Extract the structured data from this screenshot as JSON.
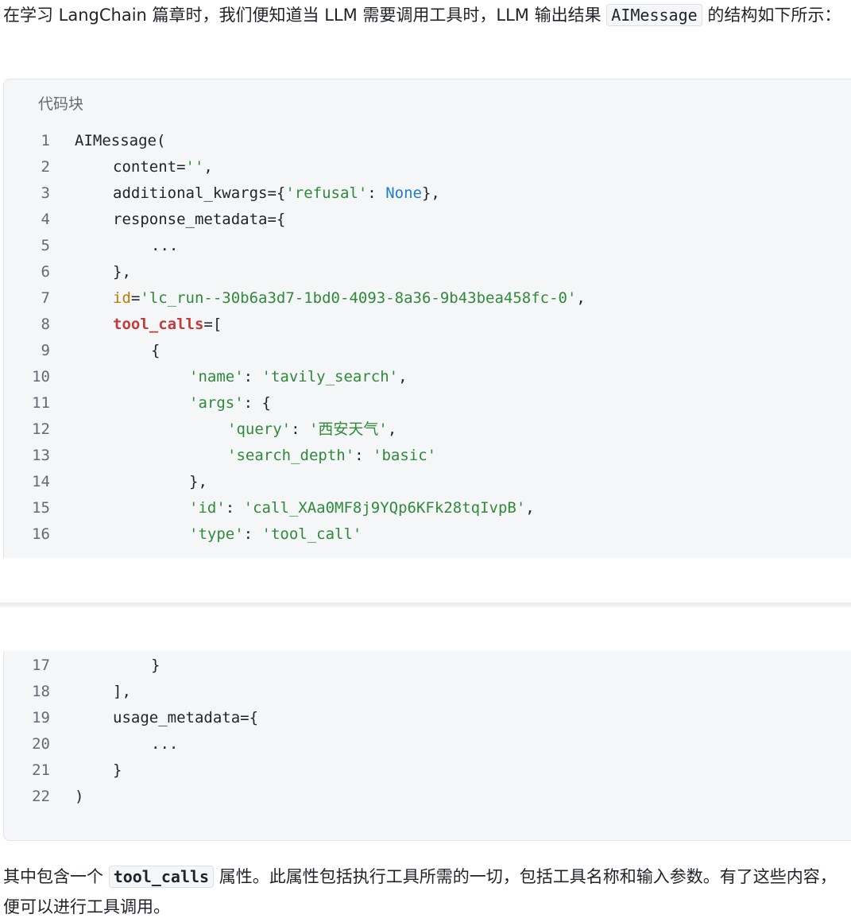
{
  "intro": {
    "text_before": "在学习 LangChain 篇章时，我们便知道当 LLM 需要调用工具时，LLM 输出结果 ",
    "code": "AIMessage",
    "text_after": " 的结构如下所示："
  },
  "code_block": {
    "label": "代码块",
    "lines": [
      {
        "n": "1",
        "indent": 0,
        "parts": [
          {
            "t": "AIMessage("
          }
        ]
      },
      {
        "n": "2",
        "indent": 1,
        "parts": [
          {
            "t": "content="
          },
          {
            "t": "''",
            "c": "str"
          },
          {
            "t": ","
          }
        ]
      },
      {
        "n": "3",
        "indent": 1,
        "parts": [
          {
            "t": "additional_kwargs={"
          },
          {
            "t": "'refusal'",
            "c": "str"
          },
          {
            "t": ": "
          },
          {
            "t": "None",
            "c": "kw"
          },
          {
            "t": "},"
          }
        ]
      },
      {
        "n": "4",
        "indent": 1,
        "parts": [
          {
            "t": "response_metadata={"
          }
        ]
      },
      {
        "n": "5",
        "indent": 2,
        "parts": [
          {
            "t": "..."
          }
        ]
      },
      {
        "n": "6",
        "indent": 1,
        "parts": [
          {
            "t": "},"
          }
        ]
      },
      {
        "n": "7",
        "indent": 1,
        "parts": [
          {
            "t": "id",
            "c": "param"
          },
          {
            "t": "="
          },
          {
            "t": "'lc_run--30b6a3d7-1bd0-4093-8a36-9b43bea458fc-0'",
            "c": "str"
          },
          {
            "t": ","
          }
        ]
      },
      {
        "n": "8",
        "indent": 1,
        "parts": [
          {
            "t": "tool_calls",
            "c": "name"
          },
          {
            "t": "=["
          }
        ]
      },
      {
        "n": "9",
        "indent": 2,
        "parts": [
          {
            "t": "{"
          }
        ]
      },
      {
        "n": "10",
        "indent": 3,
        "parts": [
          {
            "t": "'name'",
            "c": "str"
          },
          {
            "t": ": "
          },
          {
            "t": "'tavily_search'",
            "c": "str"
          },
          {
            "t": ","
          }
        ]
      },
      {
        "n": "11",
        "indent": 3,
        "parts": [
          {
            "t": "'args'",
            "c": "str"
          },
          {
            "t": ": {"
          }
        ]
      },
      {
        "n": "12",
        "indent": 4,
        "parts": [
          {
            "t": "'query'",
            "c": "str"
          },
          {
            "t": ": "
          },
          {
            "t": "'西安天气'",
            "c": "str"
          },
          {
            "t": ","
          }
        ]
      },
      {
        "n": "13",
        "indent": 4,
        "parts": [
          {
            "t": "'search_depth'",
            "c": "str"
          },
          {
            "t": ": "
          },
          {
            "t": "'basic'",
            "c": "str"
          }
        ]
      },
      {
        "n": "14",
        "indent": 3,
        "parts": [
          {
            "t": "},"
          }
        ]
      },
      {
        "n": "15",
        "indent": 3,
        "parts": [
          {
            "t": "'id'",
            "c": "str"
          },
          {
            "t": ": "
          },
          {
            "t": "'call_XAa0MF8j9YQp6KFk28tqIvpB'",
            "c": "str"
          },
          {
            "t": ","
          }
        ]
      },
      {
        "n": "16",
        "indent": 3,
        "parts": [
          {
            "t": "'type'",
            "c": "str"
          },
          {
            "t": ": "
          },
          {
            "t": "'tool_call'",
            "c": "str"
          }
        ]
      },
      {
        "n": "17",
        "indent": 2,
        "parts": [
          {
            "t": "}"
          }
        ]
      },
      {
        "n": "18",
        "indent": 1,
        "parts": [
          {
            "t": "],"
          }
        ]
      },
      {
        "n": "19",
        "indent": 1,
        "parts": [
          {
            "t": "usage_metadata={"
          }
        ]
      },
      {
        "n": "20",
        "indent": 2,
        "parts": [
          {
            "t": "..."
          }
        ]
      },
      {
        "n": "21",
        "indent": 1,
        "parts": [
          {
            "t": "}"
          }
        ]
      },
      {
        "n": "22",
        "indent": 0,
        "parts": [
          {
            "t": ")"
          }
        ]
      }
    ]
  },
  "outro": {
    "text_before": "其中包含一个 ",
    "code": "tool_calls",
    "text_after": " 属性。此属性包括执行工具所需的一切，包括工具名称和输入参数。有了这些内容，便可以进行工具调用。"
  },
  "colors": {
    "string": "#2f8a3a",
    "keyword": "#1d7fc2",
    "param": "#c07800",
    "highlight_name": "#c23b3b",
    "code_bg": "#f5f6f7"
  }
}
